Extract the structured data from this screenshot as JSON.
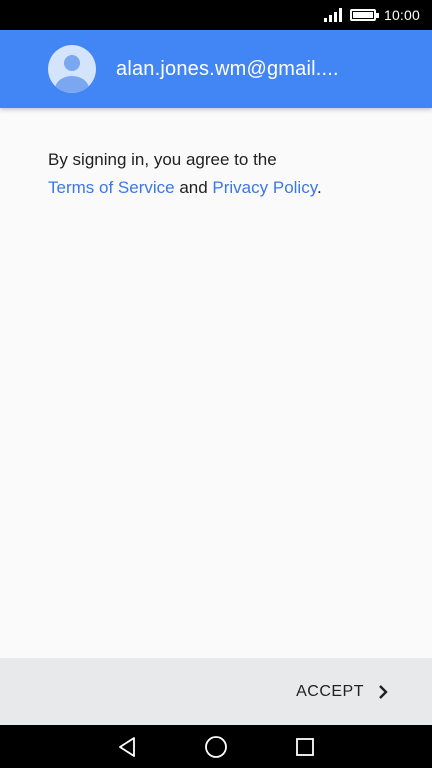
{
  "status_bar": {
    "time": "10:00"
  },
  "account": {
    "email": "alan.jones.wm@gmail....",
    "avatar_icon": "person-icon"
  },
  "terms": {
    "prefix": "By signing in, you agree to the",
    "terms_link": "Terms of Service",
    "conjunction": " and ",
    "privacy_link": "Privacy Policy",
    "suffix": "."
  },
  "actions": {
    "accept_label": "ACCEPT",
    "accept_icon": "chevron-right-icon"
  },
  "nav_bar": {
    "back_icon": "back-triangle-icon",
    "home_icon": "home-circle-icon",
    "recents_icon": "recents-square-icon"
  },
  "colors": {
    "header": "#4285f4",
    "link": "#3b78e7",
    "action_bar": "#e8e9eb",
    "background": "#fafafa"
  }
}
